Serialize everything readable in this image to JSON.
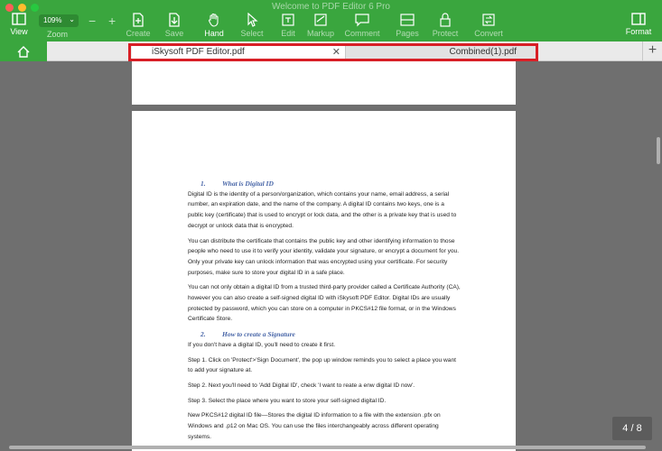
{
  "window": {
    "title": "Welcome to PDF Editor 6 Pro"
  },
  "toolbar": {
    "view": "View",
    "zoom_value": "109%",
    "zoom": "Zoom",
    "create": "Create",
    "save": "Save",
    "hand": "Hand",
    "select": "Select",
    "edit": "Edit",
    "markup": "Markup",
    "comment": "Comment",
    "pages": "Pages",
    "protect": "Protect",
    "convert": "Convert",
    "format": "Format"
  },
  "tabs": [
    {
      "label": "iSkysoft PDF Editor.pdf",
      "active": true
    },
    {
      "label": "Combined(1).pdf",
      "active": false
    }
  ],
  "document": {
    "heading1_num": "1.",
    "heading1": "What is Digital ID",
    "p1": "Digital ID is the identity of a person/organization, which contains your name, email address, a serial number, an expiration date, and the name of the company. A digital ID contains two keys, one is a public key (certificate) that is used to encrypt or lock data, and the other is a private key that is used to decrypt or unlock data that is encrypted.",
    "p2": "You can distribute the certificate that contains the public key and other identifying information to those people who need to use it to verify your identity, validate your signature, or encrypt a document for you. Only your private key can unlock information that was encrypted using your certificate. For security purposes, make sure to store your digital ID in a safe place.",
    "p3": "You can not only obtain a digital ID from a trusted third-party provider called a Certificate Authority (CA), however you can also create a self-signed digital ID with iSkysoft PDF Editor. Digital IDs are usually protected by password, which you can store on a computer in PKCS#12 file format, or in the Windows Certificate Store.",
    "heading2_num": "2.",
    "heading2": "How to create a Signature",
    "p4": "If you don't have a digital ID, you'll need to create it first.",
    "step1": "Step 1. Click on 'Protect'>'Sign Document', the pop up window reminds you to select a place you want to add your signature at.",
    "step2": "Step 2. Next you'll need to 'Add Digital ID', check 'I want to reate a enw digital ID now'.",
    "step3": "Step 3. Select the place where you want to store your self-signed digital ID.",
    "p5": "New PKCS#12 digital ID file—Stores the digital ID information to a file with the extension .pfx on Windows and .p12 on Mac OS. You can use the files interchangeably across different operating systems."
  },
  "page_counter": "4 / 8",
  "colors": {
    "toolbar": "#3aa63e",
    "highlight": "#d81f26",
    "heading": "#4563a6"
  }
}
